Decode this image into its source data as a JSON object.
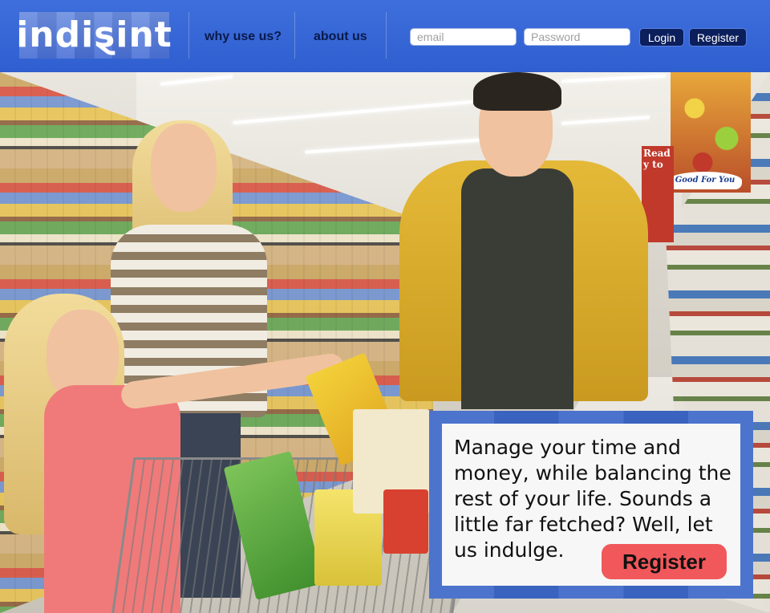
{
  "header": {
    "logo_text": "indiȿint",
    "nav": [
      {
        "label": "why use us?"
      },
      {
        "label": "about us"
      }
    ],
    "email_placeholder": "email",
    "password_placeholder": "Password",
    "login_label": "Login",
    "register_label": "Register"
  },
  "hero": {
    "signs": {
      "good_for_you": "Good For You",
      "ready_to": "Read y to"
    },
    "callout": {
      "text": "Manage your time and money, while balancing the rest of your life.  Sounds a little far fetched?  Well, let us indulge.",
      "button_label": "Register"
    }
  },
  "colors": {
    "header_blue": "#3565d4",
    "nav_text": "#0a1a4a",
    "dark_button": "#0b1f5c",
    "callout_button": "#f0585b"
  }
}
